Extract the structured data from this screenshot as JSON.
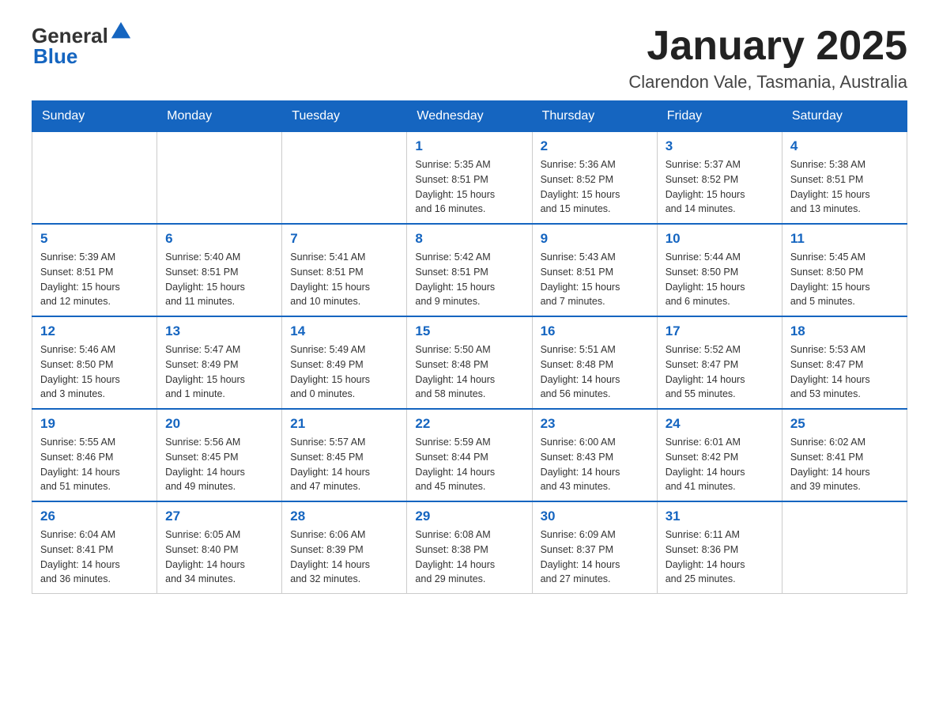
{
  "header": {
    "logo_general": "General",
    "logo_blue": "Blue",
    "title": "January 2025",
    "location": "Clarendon Vale, Tasmania, Australia"
  },
  "days_of_week": [
    "Sunday",
    "Monday",
    "Tuesday",
    "Wednesday",
    "Thursday",
    "Friday",
    "Saturday"
  ],
  "weeks": [
    [
      {
        "day": "",
        "info": ""
      },
      {
        "day": "",
        "info": ""
      },
      {
        "day": "",
        "info": ""
      },
      {
        "day": "1",
        "info": "Sunrise: 5:35 AM\nSunset: 8:51 PM\nDaylight: 15 hours\nand 16 minutes."
      },
      {
        "day": "2",
        "info": "Sunrise: 5:36 AM\nSunset: 8:52 PM\nDaylight: 15 hours\nand 15 minutes."
      },
      {
        "day": "3",
        "info": "Sunrise: 5:37 AM\nSunset: 8:52 PM\nDaylight: 15 hours\nand 14 minutes."
      },
      {
        "day": "4",
        "info": "Sunrise: 5:38 AM\nSunset: 8:51 PM\nDaylight: 15 hours\nand 13 minutes."
      }
    ],
    [
      {
        "day": "5",
        "info": "Sunrise: 5:39 AM\nSunset: 8:51 PM\nDaylight: 15 hours\nand 12 minutes."
      },
      {
        "day": "6",
        "info": "Sunrise: 5:40 AM\nSunset: 8:51 PM\nDaylight: 15 hours\nand 11 minutes."
      },
      {
        "day": "7",
        "info": "Sunrise: 5:41 AM\nSunset: 8:51 PM\nDaylight: 15 hours\nand 10 minutes."
      },
      {
        "day": "8",
        "info": "Sunrise: 5:42 AM\nSunset: 8:51 PM\nDaylight: 15 hours\nand 9 minutes."
      },
      {
        "day": "9",
        "info": "Sunrise: 5:43 AM\nSunset: 8:51 PM\nDaylight: 15 hours\nand 7 minutes."
      },
      {
        "day": "10",
        "info": "Sunrise: 5:44 AM\nSunset: 8:50 PM\nDaylight: 15 hours\nand 6 minutes."
      },
      {
        "day": "11",
        "info": "Sunrise: 5:45 AM\nSunset: 8:50 PM\nDaylight: 15 hours\nand 5 minutes."
      }
    ],
    [
      {
        "day": "12",
        "info": "Sunrise: 5:46 AM\nSunset: 8:50 PM\nDaylight: 15 hours\nand 3 minutes."
      },
      {
        "day": "13",
        "info": "Sunrise: 5:47 AM\nSunset: 8:49 PM\nDaylight: 15 hours\nand 1 minute."
      },
      {
        "day": "14",
        "info": "Sunrise: 5:49 AM\nSunset: 8:49 PM\nDaylight: 15 hours\nand 0 minutes."
      },
      {
        "day": "15",
        "info": "Sunrise: 5:50 AM\nSunset: 8:48 PM\nDaylight: 14 hours\nand 58 minutes."
      },
      {
        "day": "16",
        "info": "Sunrise: 5:51 AM\nSunset: 8:48 PM\nDaylight: 14 hours\nand 56 minutes."
      },
      {
        "day": "17",
        "info": "Sunrise: 5:52 AM\nSunset: 8:47 PM\nDaylight: 14 hours\nand 55 minutes."
      },
      {
        "day": "18",
        "info": "Sunrise: 5:53 AM\nSunset: 8:47 PM\nDaylight: 14 hours\nand 53 minutes."
      }
    ],
    [
      {
        "day": "19",
        "info": "Sunrise: 5:55 AM\nSunset: 8:46 PM\nDaylight: 14 hours\nand 51 minutes."
      },
      {
        "day": "20",
        "info": "Sunrise: 5:56 AM\nSunset: 8:45 PM\nDaylight: 14 hours\nand 49 minutes."
      },
      {
        "day": "21",
        "info": "Sunrise: 5:57 AM\nSunset: 8:45 PM\nDaylight: 14 hours\nand 47 minutes."
      },
      {
        "day": "22",
        "info": "Sunrise: 5:59 AM\nSunset: 8:44 PM\nDaylight: 14 hours\nand 45 minutes."
      },
      {
        "day": "23",
        "info": "Sunrise: 6:00 AM\nSunset: 8:43 PM\nDaylight: 14 hours\nand 43 minutes."
      },
      {
        "day": "24",
        "info": "Sunrise: 6:01 AM\nSunset: 8:42 PM\nDaylight: 14 hours\nand 41 minutes."
      },
      {
        "day": "25",
        "info": "Sunrise: 6:02 AM\nSunset: 8:41 PM\nDaylight: 14 hours\nand 39 minutes."
      }
    ],
    [
      {
        "day": "26",
        "info": "Sunrise: 6:04 AM\nSunset: 8:41 PM\nDaylight: 14 hours\nand 36 minutes."
      },
      {
        "day": "27",
        "info": "Sunrise: 6:05 AM\nSunset: 8:40 PM\nDaylight: 14 hours\nand 34 minutes."
      },
      {
        "day": "28",
        "info": "Sunrise: 6:06 AM\nSunset: 8:39 PM\nDaylight: 14 hours\nand 32 minutes."
      },
      {
        "day": "29",
        "info": "Sunrise: 6:08 AM\nSunset: 8:38 PM\nDaylight: 14 hours\nand 29 minutes."
      },
      {
        "day": "30",
        "info": "Sunrise: 6:09 AM\nSunset: 8:37 PM\nDaylight: 14 hours\nand 27 minutes."
      },
      {
        "day": "31",
        "info": "Sunrise: 6:11 AM\nSunset: 8:36 PM\nDaylight: 14 hours\nand 25 minutes."
      },
      {
        "day": "",
        "info": ""
      }
    ]
  ]
}
